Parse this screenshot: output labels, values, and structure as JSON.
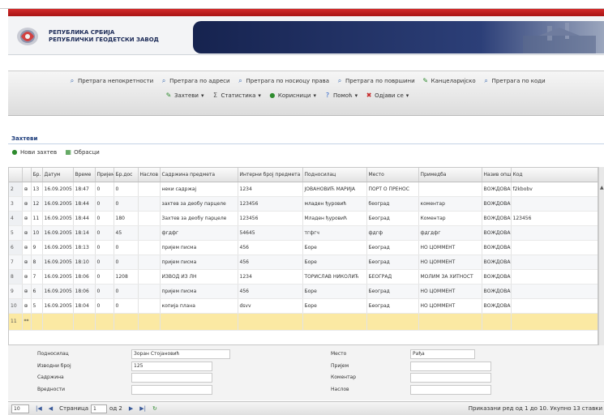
{
  "banner": {
    "org_line1": "РЕПУБЛИКА СРБИЈА",
    "org_line2": "РЕПУБЛИЧКИ ГЕОДЕТСКИ ЗАВОД"
  },
  "menu": {
    "row1": [
      {
        "label": "Претрага непокретности",
        "icon": "search-icon"
      },
      {
        "label": "Претрага по адреси",
        "icon": "search-icon"
      },
      {
        "label": "Претрага по носиоцу права",
        "icon": "search-icon"
      },
      {
        "label": "Претрага по површини",
        "icon": "search-icon"
      },
      {
        "label": "Канцеларијско",
        "icon": "pencil-icon"
      },
      {
        "label": "Претрага по коди",
        "icon": "search-icon"
      }
    ],
    "row2": [
      {
        "label": "Захтеви",
        "icon": "pencil-icon"
      },
      {
        "label": "Статистика",
        "icon": "sigma-icon"
      },
      {
        "label": "Корисници",
        "icon": "users-icon"
      },
      {
        "label": "Помоћ",
        "icon": "help-icon"
      },
      {
        "label": "Одјави се",
        "icon": "logout-icon"
      }
    ]
  },
  "section": {
    "title": "Захтеви"
  },
  "toolbar": {
    "new": "Нови захтев",
    "print": "Обрасци"
  },
  "grid": {
    "headers": [
      "",
      "",
      "Бр.",
      "Датум",
      "Време",
      "Пријем",
      "Бр.дос",
      "Наслов",
      "Садржина предмета",
      "Интерни број предмета",
      "Подносилац",
      "Место",
      "Примедба",
      "Назив општине",
      "Код"
    ],
    "rows": [
      [
        "2",
        "13",
        "16.09.2005",
        "18:47",
        "0",
        "0",
        "",
        "неки садржај",
        "1234",
        "ЈОВАНОВИЋ МАРИЈА",
        "ПОРТ О ПРЕНОС",
        "",
        "ВОЖДОВАЦ",
        "f2kbobv"
      ],
      [
        "3",
        "12",
        "16.09.2005",
        "18:44",
        "0",
        "0",
        "",
        "захтев за деобу парцеле",
        "123456",
        "младен ђуровић",
        "београд",
        "коментар",
        "ВОЖДОВАЦ",
        ""
      ],
      [
        "4",
        "11",
        "16.09.2005",
        "18:44",
        "0",
        "180",
        "",
        "Захтев за деобу парцеле",
        "123456",
        "Младен ђуровић",
        "Београд",
        "Коментар",
        "ВОЖДОВАЦ",
        "123456"
      ],
      [
        "5",
        "10",
        "16.09.2005",
        "18:14",
        "0",
        "45",
        "",
        "фгдфг",
        "54645",
        "тгфгч",
        "фдгф",
        "фдгдфг",
        "ВОЖДОВАЦ",
        ""
      ],
      [
        "6",
        "9",
        "16.09.2005",
        "18:13",
        "0",
        "0",
        "",
        "пријем писма",
        "456",
        "Боре",
        "Београд",
        "НО ЦОММЕНТ",
        "ВОЖДОВАЦ",
        ""
      ],
      [
        "7",
        "8",
        "16.09.2005",
        "18:10",
        "0",
        "0",
        "",
        "пријем писма",
        "456",
        "Боре",
        "Београд",
        "НО ЦОММЕНТ",
        "ВОЖДОВАЦ",
        ""
      ],
      [
        "8",
        "7",
        "16.09.2005",
        "18:06",
        "0",
        "1208",
        "",
        "ИЗВОД ИЗ ЛН",
        "1234",
        "ТОРИСЛАВ НИКОЛИЋ",
        "БЕОГРАД",
        "МОЛИМ ЗА ХИТНОСТ",
        "ВОЖДОВАЦ",
        ""
      ],
      [
        "9",
        "6",
        "16.09.2005",
        "18:06",
        "0",
        "0",
        "",
        "пријем писма",
        "456",
        "Боре",
        "Београд",
        "НО ЦОММЕНТ",
        "ВОЖДОВАЦ",
        ""
      ],
      [
        "10",
        "5",
        "16.09.2005",
        "18:04",
        "0",
        "0",
        "",
        "копија плана",
        "dsvv",
        "Боре",
        "Београд",
        "НО ЦОММЕНТ",
        "ВОЖДОВАЦ",
        ""
      ]
    ],
    "new_row_num": "11",
    "new_row_marker": "**"
  },
  "form": {
    "left": [
      {
        "label": "Подносилац",
        "value": "Зоран Стојановић"
      },
      {
        "label": "Изводни број",
        "value": "125"
      },
      {
        "label": "Садржина",
        "value": ""
      },
      {
        "label": "Вредности",
        "value": ""
      }
    ],
    "right": [
      {
        "label": "Место",
        "value": "Рађа"
      },
      {
        "label": "Пријем",
        "value": ""
      },
      {
        "label": "Коментар",
        "value": ""
      },
      {
        "label": "Наслов",
        "value": ""
      }
    ]
  },
  "pager": {
    "page_size": "10",
    "page_label": "Страница",
    "page_value": "1",
    "of_label": "од 2",
    "status": "Приказани ред од 1 до 10. Укупно 13 ставки"
  }
}
